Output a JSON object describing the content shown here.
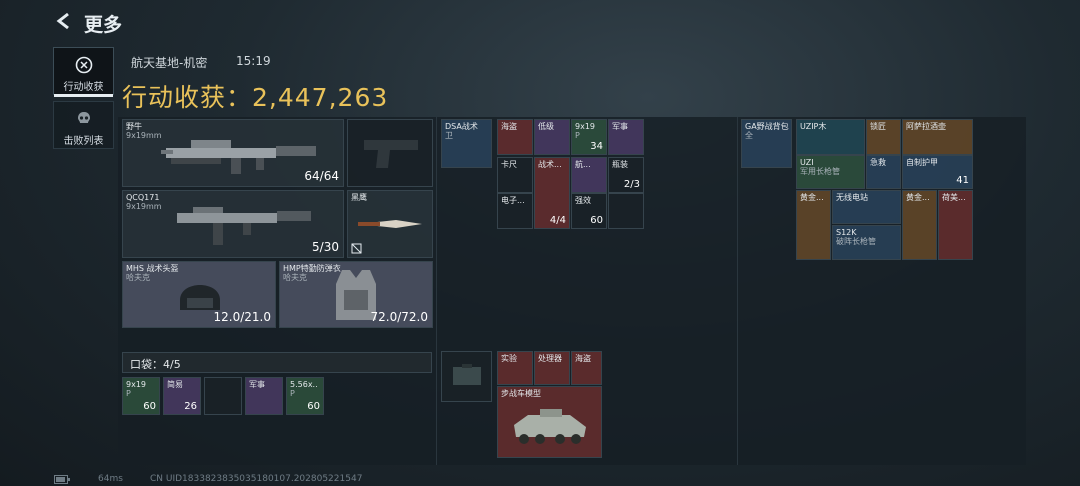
{
  "header": {
    "back_title": "更多"
  },
  "sidebar": {
    "tabs": [
      {
        "label": "行动收获"
      },
      {
        "label": "击败列表"
      }
    ]
  },
  "session": {
    "map": "航天基地-机密",
    "time": "15:19",
    "haul_label": "行动收获：",
    "haul_value": "2,447,263"
  },
  "weapons": {
    "primary": {
      "name": "野牛",
      "ammo_type": "9x19mm",
      "ammo": "64/64"
    },
    "secondary": {
      "name": "QCQ171",
      "ammo_type": "9x19mm",
      "ammo": "5/30"
    },
    "melee": {
      "name": "黑鹰"
    }
  },
  "armor": {
    "helmet": {
      "name": "MHS 战术头盔",
      "sub": "哈夫克",
      "durability": "12.0/21.0"
    },
    "vest": {
      "name": "HMP特勤防弹衣",
      "sub": "哈夫克",
      "durability": "72.0/72.0"
    }
  },
  "pockets": {
    "label": "口袋：4/5",
    "items": [
      {
        "name": "9x19",
        "sub": "P",
        "count": "60"
      },
      {
        "name": "简易",
        "count": "26"
      },
      {
        "name": ""
      },
      {
        "name": "军事"
      },
      {
        "name": "5.56x..",
        "sub": "P",
        "count": "60"
      }
    ]
  },
  "chest_rig": {
    "name": "DSA战术",
    "sub": "卫",
    "items": [
      {
        "name": "海盗"
      },
      {
        "name": "低级"
      },
      {
        "name": "9x19",
        "sub": "P",
        "count": "34"
      },
      {
        "name": "军事"
      },
      {
        "name": "卡尺"
      },
      {
        "name": "战术..."
      },
      {
        "name": "航..."
      },
      {
        "name": "瓶装",
        "count": "2/3"
      },
      {
        "name": "电子..."
      },
      {
        "name": "",
        "count": "4/4"
      },
      {
        "name": "强效",
        "count": "60"
      }
    ]
  },
  "safe_box": {
    "items": [
      {
        "name": "实验"
      },
      {
        "name": "处理器"
      },
      {
        "name": "海盗"
      },
      {
        "name": "步战车模型"
      }
    ]
  },
  "backpack": {
    "name": "GA野战背包",
    "sub": "全",
    "items": [
      {
        "name": "UZIP木"
      },
      {
        "name": "锁匠"
      },
      {
        "name": "阿萨拉酒壶"
      },
      {
        "name": "UZI",
        "sub": "军用长枪管"
      },
      {
        "name": "急救"
      },
      {
        "name": "自制护甲",
        "count": "41"
      },
      {
        "name": "黄金..."
      },
      {
        "name": "无线电站"
      },
      {
        "name": "S12K",
        "sub": "破阵长枪管"
      },
      {
        "name": "黄金..."
      },
      {
        "name": "荷美..."
      }
    ]
  },
  "footer": {
    "fps": "64ms",
    "uid": "CN UID1833823835035180107.202805221547"
  }
}
